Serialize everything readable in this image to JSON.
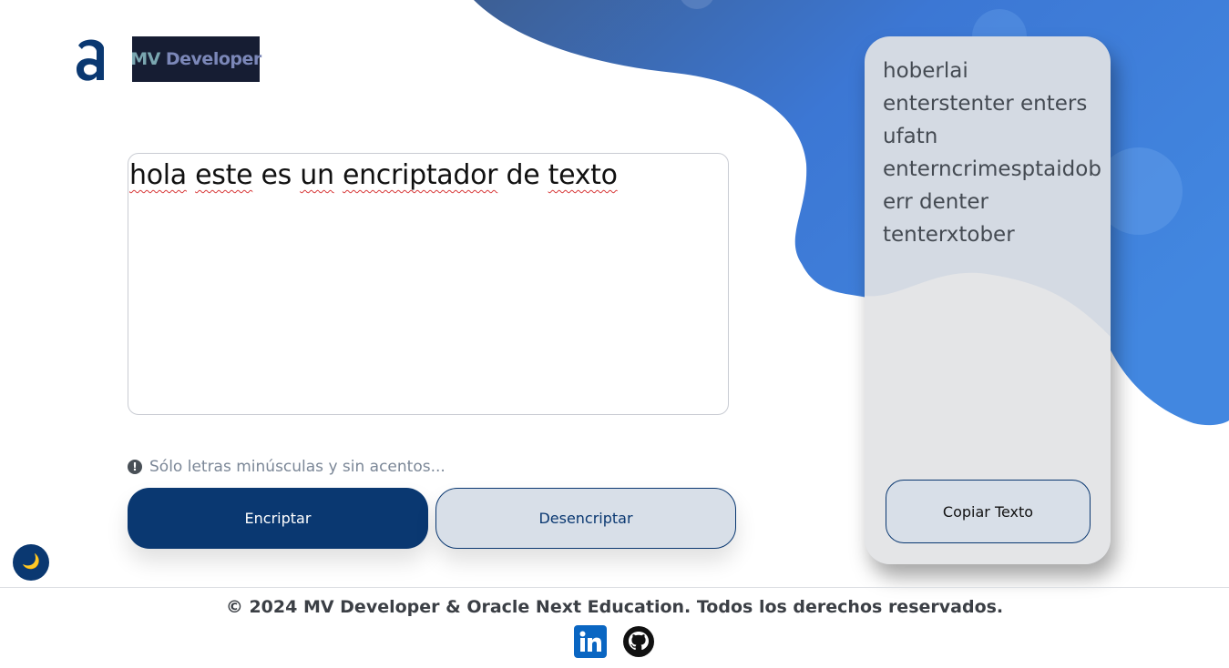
{
  "header": {
    "logo_letter": "a",
    "brand_mv": "MV",
    "brand_name": "Developer"
  },
  "input": {
    "words": [
      "hola",
      " ",
      "este",
      " ",
      "es",
      " ",
      "un",
      " ",
      "encriptador",
      " ",
      "de",
      " ",
      "texto"
    ]
  },
  "hint": {
    "icon": "exclamation-circle-icon",
    "text": "Sólo letras minúsculas y sin acentos..."
  },
  "buttons": {
    "encrypt_label": "Encriptar",
    "decrypt_label": "Desencriptar",
    "copy_label": "Copiar Texto"
  },
  "output": {
    "text": "hoberlai enterstenter enters ufatn enterncrimesptaidoberr denter tenterxtober"
  },
  "theme_toggle": {
    "icon": "moon-icon",
    "glyph": "🌙"
  },
  "footer": {
    "copyright": "© 2024 MV Developer & Oracle Next Education. Todos los derechos reservados.",
    "social": [
      "linkedin-icon",
      "github-icon"
    ]
  },
  "colors": {
    "primary": "#0a3871",
    "secondary_bg": "#d8dfe8",
    "blob_blue": "#3f7fd6",
    "card_bg": "#d4dae3"
  }
}
